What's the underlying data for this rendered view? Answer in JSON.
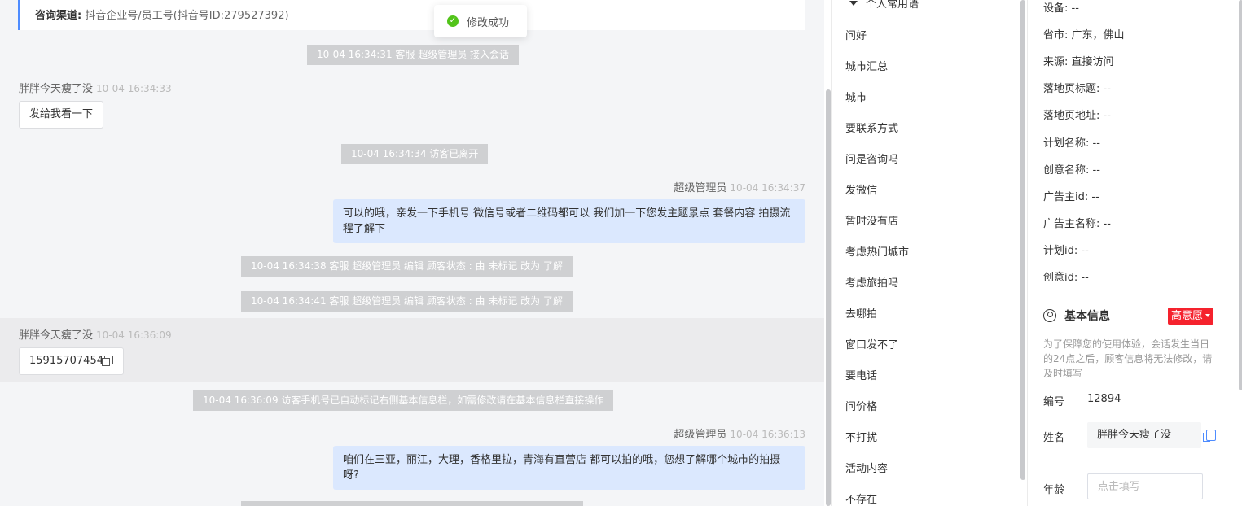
{
  "chat": {
    "channel_label": "咨询渠道:",
    "channel_value": "抖音企业号/员工号(抖音号ID:279527392)",
    "toast": "修改成功",
    "sys1": "10-04 16:34:31 客服 超级管理员 接入会话",
    "visitor_name": "胖胖今天瘦了没",
    "msg1_time": "10-04 16:34:33",
    "msg1_text": "发给我看一下",
    "sys2": "10-04 16:34:34 访客已离开",
    "agent_name": "超级管理员",
    "msg2_time": "10-04 16:34:37",
    "msg2_text": "可以的哦，亲发一下手机号 微信号或者二维码都可以 我们加一下您发主题景点 套餐内容 拍摄流程了解下",
    "sys3": "10-04 16:34:38 客服 超级管理员 编辑 顾客状态 : 由 未标记 改为 了解",
    "sys4": "10-04 16:34:41 客服 超级管理员 编辑 顾客状态 : 由 未标记 改为 了解",
    "msg3_time": "10-04 16:36:09",
    "msg3_text": "15915707454",
    "sys5": "10-04 16:36:09 访客手机号已自动标记右侧基本信息栏，如需修改请在基本信息栏直接操作",
    "msg4_time": "10-04 16:36:13",
    "msg4_text": "咱们在三亚，丽江，大理，香格里拉，青海有直营店 都可以拍的哦，您想了解哪个城市的拍摄呀?"
  },
  "phrases": {
    "header": "个人常用语",
    "items": [
      "问好",
      "城市汇总",
      "城市",
      "要联系方式",
      "问是咨询吗",
      "发微信",
      "暂时没有店",
      "考虑热门城市",
      "考虑旅拍吗",
      "去哪拍",
      "窗口发不了",
      "要电话",
      "问价格",
      "不打扰",
      "活动内容",
      "不存在"
    ]
  },
  "info": {
    "rows": [
      "设备: --",
      "省市: 广东，佛山",
      "来源: 直接访问",
      "落地页标题: --",
      "落地页地址: --",
      "计划名称: --",
      "创意名称: --",
      "广告主id: --",
      "广告主名称: --",
      "计划id: --",
      "创意id: --"
    ],
    "section_title": "基本信息",
    "intent_label": "高意愿",
    "notice": "为了保障您的使用体验，会话发生当日的24点之后，顾客信息将无法修改，请及时填写",
    "id_label": "编号",
    "id_value": "12894",
    "name_label": "姓名",
    "name_value": "胖胖今天瘦了没",
    "age_label": "年龄",
    "age_placeholder": "点击填写"
  }
}
